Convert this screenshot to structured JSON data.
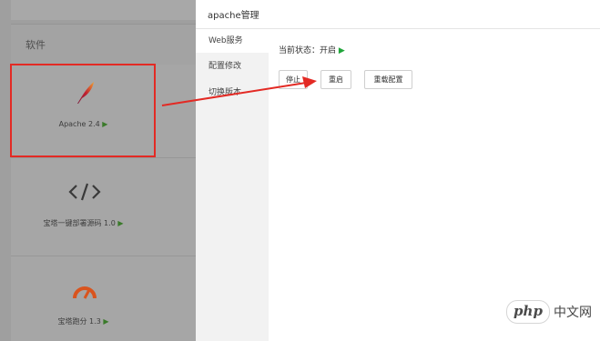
{
  "background": {
    "section_label": "软件",
    "software": [
      {
        "name": "Apache 2.4",
        "icon": "feather-icon",
        "status": "▶"
      },
      {
        "name": "宝塔一键部署源码 1.0",
        "icon": "code-icon",
        "status": "▶"
      },
      {
        "name": "宝塔跑分 1.3",
        "icon": "gauge-icon",
        "status": "▶"
      }
    ]
  },
  "modal": {
    "title": "apache管理",
    "side_menu": [
      {
        "label": "Web服务"
      },
      {
        "label": "配置修改"
      },
      {
        "label": "切换版本"
      }
    ],
    "status_label": "当前状态：开启",
    "status_icon": "▶",
    "buttons": {
      "stop": "停止",
      "restart": "重启",
      "reload": "重载配置"
    }
  },
  "watermark": {
    "logo": "php",
    "text": "中文网"
  },
  "colors": {
    "highlight": "#e32a24",
    "running": "#20a53a",
    "play": "#3a7a2a"
  }
}
